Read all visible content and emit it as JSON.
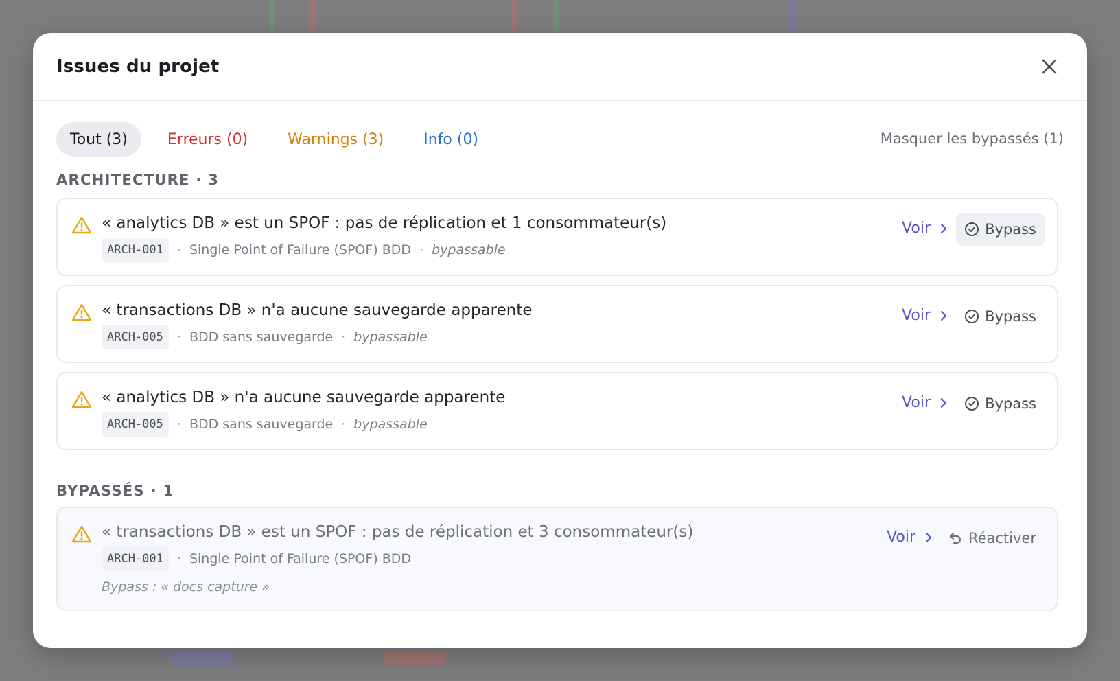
{
  "modal": {
    "title": "Issues du projet"
  },
  "filters": {
    "all": "Tout (3)",
    "errors": "Erreurs (0)",
    "warnings": "Warnings (3)",
    "info": "Info (0)",
    "hide_bypassed": "Masquer les bypassés (1)"
  },
  "sections": {
    "architecture": "ARCHITECTURE · 3",
    "bypassed": "BYPASSÉS · 1"
  },
  "issues": [
    {
      "title": "« analytics DB » est un SPOF : pas de réplication et 1 consommateur(s)",
      "code": "ARCH-001",
      "rule": "Single Point of Failure (SPOF) BDD",
      "tag": "bypassable",
      "view_label": "Voir",
      "action_label": "Bypass"
    },
    {
      "title": "« transactions DB » n'a aucune sauvegarde apparente",
      "code": "ARCH-005",
      "rule": "BDD sans sauvegarde",
      "tag": "bypassable",
      "view_label": "Voir",
      "action_label": "Bypass"
    },
    {
      "title": "« analytics DB » n'a aucune sauvegarde apparente",
      "code": "ARCH-005",
      "rule": "BDD sans sauvegarde",
      "tag": "bypassable",
      "view_label": "Voir",
      "action_label": "Bypass"
    }
  ],
  "bypassed_issues": [
    {
      "title": "« transactions DB » est un SPOF : pas de réplication et 3 consommateur(s)",
      "code": "ARCH-001",
      "rule": "Single Point of Failure (SPOF) BDD",
      "note": "Bypass : « docs capture »",
      "view_label": "Voir",
      "action_label": "Réactiver"
    }
  ],
  "colors": {
    "warning": "#e9a617",
    "error": "#d1302a",
    "info": "#2f6fd0",
    "link": "#5b55c9"
  }
}
